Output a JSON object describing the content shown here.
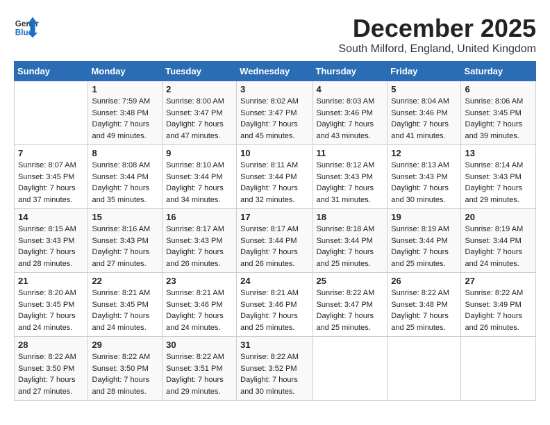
{
  "logo": {
    "general": "General",
    "blue": "Blue"
  },
  "title": {
    "month_year": "December 2025",
    "location": "South Milford, England, United Kingdom"
  },
  "columns": [
    "Sunday",
    "Monday",
    "Tuesday",
    "Wednesday",
    "Thursday",
    "Friday",
    "Saturday"
  ],
  "weeks": [
    [
      {
        "day": "",
        "sunrise": "",
        "sunset": "",
        "daylight": ""
      },
      {
        "day": "1",
        "sunrise": "Sunrise: 7:59 AM",
        "sunset": "Sunset: 3:48 PM",
        "daylight": "Daylight: 7 hours and 49 minutes."
      },
      {
        "day": "2",
        "sunrise": "Sunrise: 8:00 AM",
        "sunset": "Sunset: 3:47 PM",
        "daylight": "Daylight: 7 hours and 47 minutes."
      },
      {
        "day": "3",
        "sunrise": "Sunrise: 8:02 AM",
        "sunset": "Sunset: 3:47 PM",
        "daylight": "Daylight: 7 hours and 45 minutes."
      },
      {
        "day": "4",
        "sunrise": "Sunrise: 8:03 AM",
        "sunset": "Sunset: 3:46 PM",
        "daylight": "Daylight: 7 hours and 43 minutes."
      },
      {
        "day": "5",
        "sunrise": "Sunrise: 8:04 AM",
        "sunset": "Sunset: 3:46 PM",
        "daylight": "Daylight: 7 hours and 41 minutes."
      },
      {
        "day": "6",
        "sunrise": "Sunrise: 8:06 AM",
        "sunset": "Sunset: 3:45 PM",
        "daylight": "Daylight: 7 hours and 39 minutes."
      }
    ],
    [
      {
        "day": "7",
        "sunrise": "Sunrise: 8:07 AM",
        "sunset": "Sunset: 3:45 PM",
        "daylight": "Daylight: 7 hours and 37 minutes."
      },
      {
        "day": "8",
        "sunrise": "Sunrise: 8:08 AM",
        "sunset": "Sunset: 3:44 PM",
        "daylight": "Daylight: 7 hours and 35 minutes."
      },
      {
        "day": "9",
        "sunrise": "Sunrise: 8:10 AM",
        "sunset": "Sunset: 3:44 PM",
        "daylight": "Daylight: 7 hours and 34 minutes."
      },
      {
        "day": "10",
        "sunrise": "Sunrise: 8:11 AM",
        "sunset": "Sunset: 3:44 PM",
        "daylight": "Daylight: 7 hours and 32 minutes."
      },
      {
        "day": "11",
        "sunrise": "Sunrise: 8:12 AM",
        "sunset": "Sunset: 3:43 PM",
        "daylight": "Daylight: 7 hours and 31 minutes."
      },
      {
        "day": "12",
        "sunrise": "Sunrise: 8:13 AM",
        "sunset": "Sunset: 3:43 PM",
        "daylight": "Daylight: 7 hours and 30 minutes."
      },
      {
        "day": "13",
        "sunrise": "Sunrise: 8:14 AM",
        "sunset": "Sunset: 3:43 PM",
        "daylight": "Daylight: 7 hours and 29 minutes."
      }
    ],
    [
      {
        "day": "14",
        "sunrise": "Sunrise: 8:15 AM",
        "sunset": "Sunset: 3:43 PM",
        "daylight": "Daylight: 7 hours and 28 minutes."
      },
      {
        "day": "15",
        "sunrise": "Sunrise: 8:16 AM",
        "sunset": "Sunset: 3:43 PM",
        "daylight": "Daylight: 7 hours and 27 minutes."
      },
      {
        "day": "16",
        "sunrise": "Sunrise: 8:17 AM",
        "sunset": "Sunset: 3:43 PM",
        "daylight": "Daylight: 7 hours and 26 minutes."
      },
      {
        "day": "17",
        "sunrise": "Sunrise: 8:17 AM",
        "sunset": "Sunset: 3:44 PM",
        "daylight": "Daylight: 7 hours and 26 minutes."
      },
      {
        "day": "18",
        "sunrise": "Sunrise: 8:18 AM",
        "sunset": "Sunset: 3:44 PM",
        "daylight": "Daylight: 7 hours and 25 minutes."
      },
      {
        "day": "19",
        "sunrise": "Sunrise: 8:19 AM",
        "sunset": "Sunset: 3:44 PM",
        "daylight": "Daylight: 7 hours and 25 minutes."
      },
      {
        "day": "20",
        "sunrise": "Sunrise: 8:19 AM",
        "sunset": "Sunset: 3:44 PM",
        "daylight": "Daylight: 7 hours and 24 minutes."
      }
    ],
    [
      {
        "day": "21",
        "sunrise": "Sunrise: 8:20 AM",
        "sunset": "Sunset: 3:45 PM",
        "daylight": "Daylight: 7 hours and 24 minutes."
      },
      {
        "day": "22",
        "sunrise": "Sunrise: 8:21 AM",
        "sunset": "Sunset: 3:45 PM",
        "daylight": "Daylight: 7 hours and 24 minutes."
      },
      {
        "day": "23",
        "sunrise": "Sunrise: 8:21 AM",
        "sunset": "Sunset: 3:46 PM",
        "daylight": "Daylight: 7 hours and 24 minutes."
      },
      {
        "day": "24",
        "sunrise": "Sunrise: 8:21 AM",
        "sunset": "Sunset: 3:46 PM",
        "daylight": "Daylight: 7 hours and 25 minutes."
      },
      {
        "day": "25",
        "sunrise": "Sunrise: 8:22 AM",
        "sunset": "Sunset: 3:47 PM",
        "daylight": "Daylight: 7 hours and 25 minutes."
      },
      {
        "day": "26",
        "sunrise": "Sunrise: 8:22 AM",
        "sunset": "Sunset: 3:48 PM",
        "daylight": "Daylight: 7 hours and 25 minutes."
      },
      {
        "day": "27",
        "sunrise": "Sunrise: 8:22 AM",
        "sunset": "Sunset: 3:49 PM",
        "daylight": "Daylight: 7 hours and 26 minutes."
      }
    ],
    [
      {
        "day": "28",
        "sunrise": "Sunrise: 8:22 AM",
        "sunset": "Sunset: 3:50 PM",
        "daylight": "Daylight: 7 hours and 27 minutes."
      },
      {
        "day": "29",
        "sunrise": "Sunrise: 8:22 AM",
        "sunset": "Sunset: 3:50 PM",
        "daylight": "Daylight: 7 hours and 28 minutes."
      },
      {
        "day": "30",
        "sunrise": "Sunrise: 8:22 AM",
        "sunset": "Sunset: 3:51 PM",
        "daylight": "Daylight: 7 hours and 29 minutes."
      },
      {
        "day": "31",
        "sunrise": "Sunrise: 8:22 AM",
        "sunset": "Sunset: 3:52 PM",
        "daylight": "Daylight: 7 hours and 30 minutes."
      },
      {
        "day": "",
        "sunrise": "",
        "sunset": "",
        "daylight": ""
      },
      {
        "day": "",
        "sunrise": "",
        "sunset": "",
        "daylight": ""
      },
      {
        "day": "",
        "sunrise": "",
        "sunset": "",
        "daylight": ""
      }
    ]
  ]
}
